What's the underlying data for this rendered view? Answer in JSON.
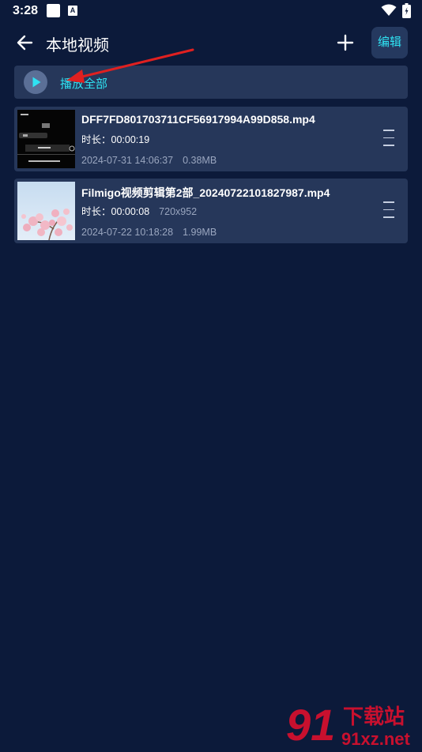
{
  "status_bar": {
    "time": "3:28"
  },
  "app_bar": {
    "title": "本地视频",
    "edit_label": "编辑"
  },
  "play_all": {
    "label": "播放全部"
  },
  "videos": [
    {
      "file_name": "DFF7FD801703711CF56917994A99D858.mp4",
      "duration_label": "时长：00:00:19",
      "resolution": "",
      "date": "2024-07-31 14:06:37",
      "size": "0.38MB",
      "thumbnail": "dark-screenshot"
    },
    {
      "file_name": "Filmigo视频剪辑第2部_20240722101827987.mp4",
      "duration_label": "时长：00:00:08",
      "resolution": "720x952",
      "date": "2024-07-22 10:18:28",
      "size": "1.99MB",
      "thumbnail": "cherry-blossoms"
    }
  ],
  "watermark": {
    "text": "91xz.net",
    "cn_text": "下载站"
  },
  "colors": {
    "background": "#0c1a3a",
    "card": "#26375a",
    "accent": "#2fe2f2",
    "arrow": "#e02020"
  },
  "icons": [
    "back-arrow-icon",
    "plus-icon",
    "play-icon",
    "drag-handle-icon",
    "wifi-icon",
    "battery-icon"
  ]
}
